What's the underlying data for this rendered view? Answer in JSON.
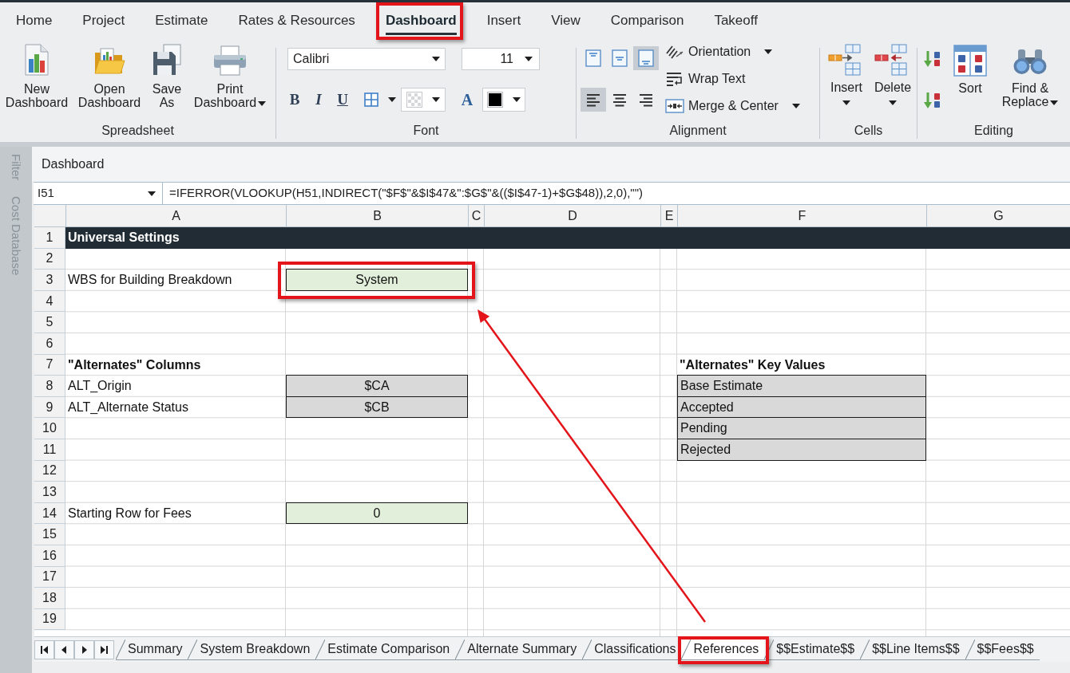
{
  "tabs": [
    {
      "label": "Home",
      "selected": false,
      "highlighted": false
    },
    {
      "label": "Project",
      "selected": false,
      "highlighted": false
    },
    {
      "label": "Estimate",
      "selected": false,
      "highlighted": false
    },
    {
      "label": "Rates & Resources",
      "selected": false,
      "highlighted": false
    },
    {
      "label": "Dashboard",
      "selected": true,
      "highlighted": true
    },
    {
      "label": "Insert",
      "selected": false,
      "highlighted": false
    },
    {
      "label": "View",
      "selected": false,
      "highlighted": false
    },
    {
      "label": "Comparison",
      "selected": false,
      "highlighted": false
    },
    {
      "label": "Takeoff",
      "selected": false,
      "highlighted": false
    }
  ],
  "ribbon": {
    "spreadsheet": {
      "label": "Spreadsheet",
      "buttons": [
        {
          "label": "New Dashboard",
          "dropdown": false
        },
        {
          "label": "Open Dashboard",
          "dropdown": false
        },
        {
          "label": "Save As",
          "dropdown": false
        },
        {
          "label": "Print Dashboard",
          "dropdown": true
        }
      ]
    },
    "font": {
      "label": "Font",
      "font_name": "Calibri",
      "font_size": "11",
      "style_buttons": [
        {
          "label": "B"
        },
        {
          "label": "I"
        },
        {
          "label": "U"
        }
      ],
      "font_color_label": "A"
    },
    "alignment": {
      "label": "Alignment",
      "vertical": [
        {
          "selected": false
        },
        {
          "selected": false
        },
        {
          "selected": true
        }
      ],
      "horizontal": [
        {
          "selected": true
        },
        {
          "selected": false
        },
        {
          "selected": false
        }
      ],
      "commands": [
        {
          "label": "Orientation",
          "dropdown": true
        },
        {
          "label": "Wrap Text",
          "dropdown": false
        },
        {
          "label": "Merge & Center",
          "dropdown": true
        }
      ]
    },
    "cells": {
      "label": "Cells",
      "buttons": [
        {
          "label": "Insert",
          "dropdown": true
        },
        {
          "label": "Delete",
          "dropdown": true
        }
      ]
    },
    "editing": {
      "label": "Editing",
      "buttons": [
        {
          "label": "Sort",
          "dropdown": false
        },
        {
          "label": "Find & Replace",
          "dropdown": true
        }
      ]
    }
  },
  "side_panel": {
    "tabs": [
      {
        "label": "Filter"
      },
      {
        "label": "Cost Database"
      }
    ]
  },
  "sheet_title": "Dashboard",
  "formula_bar": {
    "cell_reference": "I51",
    "formula": "=IFERROR(VLOOKUP(H51,INDIRECT(\"$F$\"&$I$47&\":$G$\"&(($I$47-1)+$G$48)),2,0),\"\")"
  },
  "grid": {
    "columns": [
      {
        "label": "A"
      },
      {
        "label": "B"
      },
      {
        "label": "C"
      },
      {
        "label": "D"
      },
      {
        "label": "E"
      },
      {
        "label": "F"
      },
      {
        "label": "G"
      }
    ],
    "rows": [
      {
        "number": "1",
        "kind": "banner",
        "title": "Universal Settings"
      },
      {
        "number": "2",
        "kind": "cells"
      },
      {
        "number": "3",
        "kind": "cells",
        "cells": {
          "column_a": {
            "kind": "label",
            "text": "WBS for Building Breakdown",
            "highlighted": false
          },
          "column_b": {
            "kind": "input",
            "text": "System",
            "highlighted": true
          }
        }
      },
      {
        "number": "4",
        "kind": "cells"
      },
      {
        "number": "5",
        "kind": "cells"
      },
      {
        "number": "6",
        "kind": "cells"
      },
      {
        "number": "7",
        "kind": "cells",
        "cells": {
          "column_a": {
            "kind": "heading",
            "text": "\"Alternates\" Columns",
            "highlighted": false
          },
          "column_f": {
            "kind": "heading",
            "text": "\"Alternates\" Key Values",
            "highlighted": false
          }
        }
      },
      {
        "number": "8",
        "kind": "cells",
        "cells": {
          "column_a": {
            "kind": "label",
            "text": "ALT_Origin",
            "highlighted": false
          },
          "column_b": {
            "kind": "reference",
            "text": "$CA",
            "highlighted": false
          },
          "column_f": {
            "kind": "key_value",
            "text": "Base Estimate",
            "highlighted": false
          }
        }
      },
      {
        "number": "9",
        "kind": "cells",
        "cells": {
          "column_a": {
            "kind": "label",
            "text": "ALT_Alternate Status",
            "highlighted": false
          },
          "column_b": {
            "kind": "reference",
            "text": "$CB",
            "highlighted": false
          },
          "column_f": {
            "kind": "key_value",
            "text": "Accepted",
            "highlighted": false
          }
        }
      },
      {
        "number": "10",
        "kind": "cells",
        "cells": {
          "column_f": {
            "kind": "key_value",
            "text": "Pending",
            "highlighted": false
          }
        }
      },
      {
        "number": "11",
        "kind": "cells",
        "cells": {
          "column_f": {
            "kind": "key_value",
            "text": "Rejected",
            "highlighted": false
          }
        }
      },
      {
        "number": "12",
        "kind": "cells"
      },
      {
        "number": "13",
        "kind": "cells"
      },
      {
        "number": "14",
        "kind": "cells",
        "cells": {
          "column_a": {
            "kind": "label",
            "text": "Starting Row for Fees",
            "highlighted": false
          },
          "column_b": {
            "kind": "input",
            "text": "0",
            "highlighted": false
          }
        }
      },
      {
        "number": "15",
        "kind": "cells"
      },
      {
        "number": "16",
        "kind": "cells"
      },
      {
        "number": "17",
        "kind": "cells"
      },
      {
        "number": "18",
        "kind": "cells"
      },
      {
        "number": "19",
        "kind": "cells"
      }
    ]
  },
  "sheet_tabs": [
    {
      "label": "Summary",
      "selected": false,
      "highlighted": false
    },
    {
      "label": "System Breakdown",
      "selected": false,
      "highlighted": false
    },
    {
      "label": "Estimate Comparison",
      "selected": false,
      "highlighted": false
    },
    {
      "label": "Alternate Summary",
      "selected": false,
      "highlighted": false
    },
    {
      "label": "Classifications",
      "selected": false,
      "highlighted": false
    },
    {
      "label": "References",
      "selected": true,
      "highlighted": true
    },
    {
      "label": "$$Estimate$$",
      "selected": false,
      "highlighted": false
    },
    {
      "label": "$$Line Items$$",
      "selected": false,
      "highlighted": false
    },
    {
      "label": "$$Fees$$",
      "selected": false,
      "highlighted": false
    }
  ],
  "annotation_arrow": true
}
